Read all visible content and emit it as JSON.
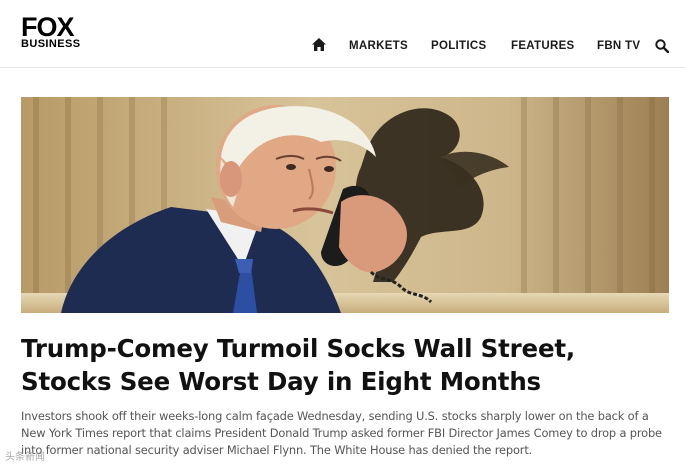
{
  "header": {
    "logo_top": "FOX",
    "logo_bottom": "BUSINESS",
    "nav": {
      "home_icon": "home-icon",
      "items": [
        "MARKETS",
        "POLITICS",
        "FEATURES",
        "FBN TV"
      ],
      "search_icon": "search-icon"
    }
  },
  "article": {
    "headline": "Trump-Comey Turmoil Socks Wall Street, Stocks See Worst Day in Eight Months",
    "summary": "Investors shook off their weeks-long calm façade Wednesday, sending U.S. stocks sharply lower on the back of a New York Times report that claims President Donald Trump asked former FBI Director James Comey to drop a probe into former national security adviser Michael Flynn. The White House has denied the report."
  },
  "watermark": "头条新闻"
}
